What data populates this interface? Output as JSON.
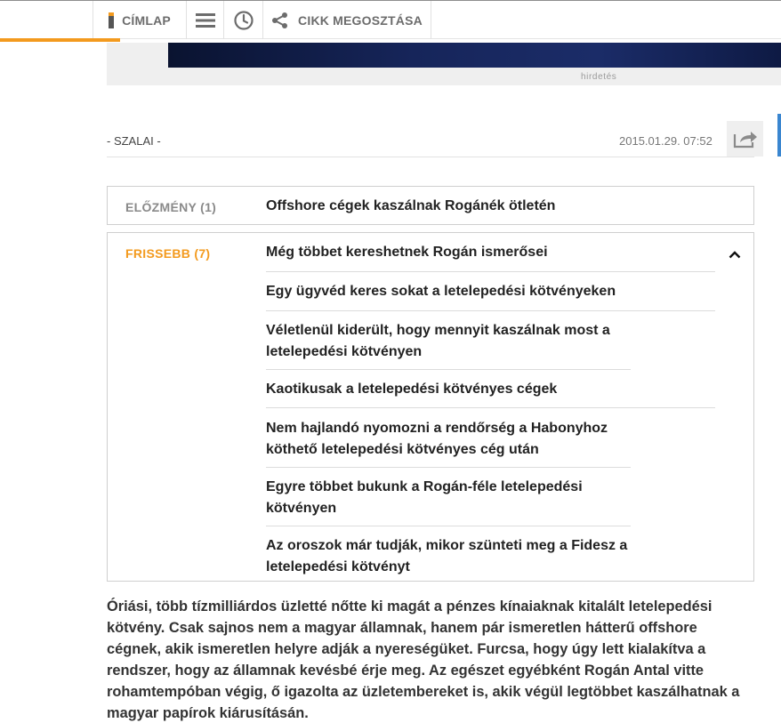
{
  "topbar": {
    "home_label": "CÍMLAP",
    "menu_icon": "hamburger-icon",
    "clock_icon": "clock-icon",
    "share_icon": "share-icon",
    "share_label": "CIKK MEGOSZTÁSA"
  },
  "ad": {
    "label": "hirdetés"
  },
  "article": {
    "author": "- SZALAI -",
    "date": "2015.01.29. 07:52"
  },
  "previous": {
    "label": "ELŐZMÉNY (1)",
    "title": "Offshore cégek kaszálnak Rogánék ötletén"
  },
  "newer": {
    "label": "FRISSEBB (7)",
    "items": [
      "Még többet kereshetnek Rogán ismerősei",
      "Egy ügyvéd keres sokat a letelepedési kötvényeken",
      "Véletlenül kiderült, hogy mennyit kaszálnak most a letelepedési kötvényen",
      "Kaotikusak a letelepedési kötvényes cégek",
      "Nem hajlandó nyomozni a rendőrség a Habonyhoz köthető letelepedési kötvényes cég után",
      "Egyre többet bukunk a Rogán-féle letelepedési kötvényen",
      "Az oroszok már tudják, mikor szünteti meg a Fidesz a letelepedési kötvényt"
    ]
  },
  "body": {
    "lead": "Óriási, több tízmilliárdos üzletté nőtte ki magát a pénzes kínaiaknak kitalált letelepedési kötvény. Csak sajnos nem a magyar államnak, hanem pár ismeretlen hátterű offshore cégnek, akik ismeretlen helyre adják a nyereségüket. Furcsa, hogy úgy lett kialakítva a rendszer, hogy az államnak kevésbé érje meg. Az egészet egyébként Rogán Antal vitte rohamtempóban végig, ő igazolta az üzletembereket is, akik végül legtöbbet kaszálhatnak a magyar papírok kiárusításán."
  },
  "colors": {
    "accent": "#f39a1e",
    "link_blue": "#3a86d0"
  }
}
